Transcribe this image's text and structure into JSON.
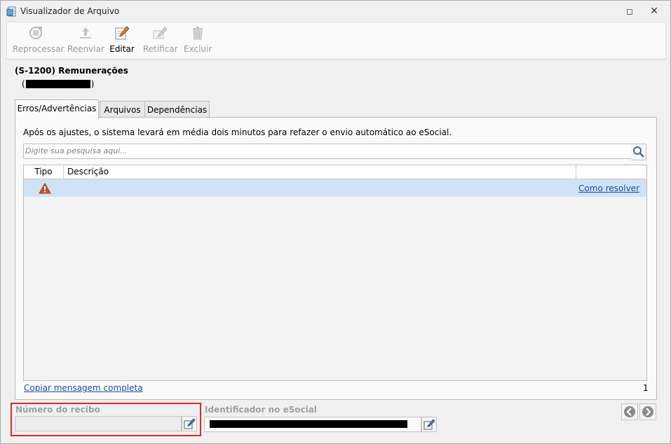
{
  "window": {
    "title": "Visualizador de Arquivo",
    "restore_glyph": "◻",
    "close_glyph": "✕"
  },
  "toolbar": {
    "buttons": [
      {
        "label": "Reprocessar",
        "icon": "reprocess-icon",
        "enabled": false
      },
      {
        "label": "Reenviar",
        "icon": "upload-icon",
        "enabled": false
      },
      {
        "label": "Editar",
        "icon": "edit-icon",
        "enabled": true
      },
      {
        "label": "Retificar",
        "icon": "rectify-icon",
        "enabled": false
      },
      {
        "label": "Excluir",
        "icon": "trash-icon",
        "enabled": false
      }
    ]
  },
  "event": {
    "title": "(S-1200) Remunerações",
    "open_paren": "(",
    "close_paren": ")"
  },
  "tabs": [
    {
      "label": "Erros/Advertências",
      "active": true
    },
    {
      "label": "Arquivos",
      "active": false
    },
    {
      "label": "Dependências",
      "active": false
    }
  ],
  "errors_tab": {
    "info_text": "Após os ajustes, o sistema levará em média dois minutos para refazer o envio automático ao eSocial.",
    "search_placeholder": "Digite sua pesquisa aqui...",
    "columns": [
      "Tipo",
      "Descrição"
    ],
    "rows": [
      {
        "type_icon": "warning-icon",
        "description": "",
        "action": "Como resolver"
      }
    ],
    "copy_link": "Copiar mensagem completa",
    "count": "1"
  },
  "footer": {
    "receipt_label": "Número do recibo",
    "receipt_value": "",
    "identifier_label": "Identificador no eSocial"
  },
  "colors": {
    "highlight_border": "#e0262b",
    "selected_row": "#cfe3f5",
    "link": "#1a4e9c"
  }
}
